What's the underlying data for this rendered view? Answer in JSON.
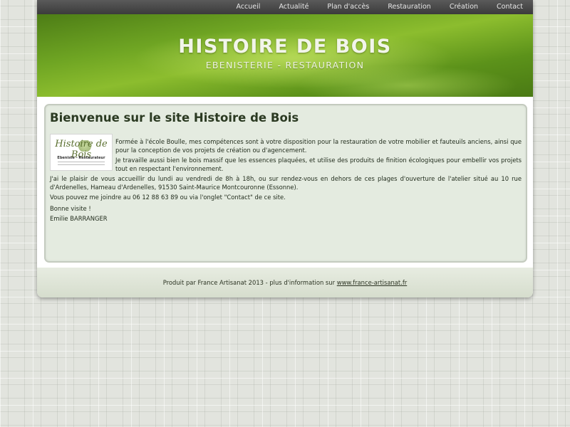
{
  "nav": {
    "items": [
      "Accueil",
      "Actualité",
      "Plan d'accès",
      "Restauration",
      "Création",
      "Contact"
    ]
  },
  "banner": {
    "title": "HISTOIRE DE BOIS",
    "subtitle": "EBENISTERIE - RESTAURATION"
  },
  "main": {
    "heading": "Bienvenue sur le site Histoire de Bois",
    "logo": {
      "text": "Histoire de Bois",
      "caption": "Ebeniste - Restaurateur",
      "icon": "leaf-logo-icon"
    },
    "paragraphs": {
      "intro1": "Formée à l'école Boulle, mes compétences sont à votre disposition pour la restauration de votre mobilier et fauteuils anciens, ainsi que pour la conception de vos projets de création ou d'agencement.",
      "intro2": "Je travaille aussi bien le bois massif que les essences plaquées, et utilise des produits de finition écologiques pour embellir vos projets tout en respectant l'environnement.",
      "hours": "J'ai le plaisir de vous accueillir du lundi au vendredi de 8h à 18h, ou sur rendez-vous en dehors de ces plages d'ouverture de l'atelier situé au 10 rue d'Ardenelles, Hameau d'Ardenelles, 91530 Saint-Maurice Montcouronne (Essonne).",
      "contact": "Vous pouvez me joindre au 06 12 88 63 89 ou via l'onglet \"Contact\" de ce site.",
      "visit": "Bonne visite !",
      "signature": "Emilie BARRANGER"
    }
  },
  "footer": {
    "text": "Produit par France Artisanat 2013 - plus d'information sur ",
    "link": "www.france-artisanat.fr"
  },
  "colors": {
    "banner_green": "#6fa523",
    "nav_bg": "#3b3b3b",
    "content_bg": "#e4ebe0"
  }
}
